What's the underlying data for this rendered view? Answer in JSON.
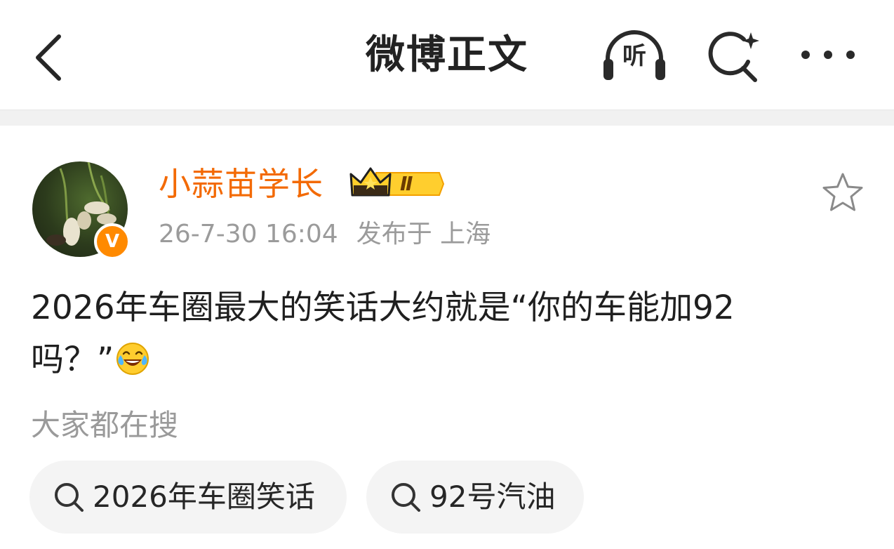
{
  "header": {
    "title": "微博正文",
    "listen_label": "听",
    "icons": [
      "back-arrow-icon",
      "headphones-icon",
      "search-sparkle-icon",
      "more-dots-icon"
    ]
  },
  "author": {
    "name": "小蒜苗学长",
    "badge_level": "Ⅱ",
    "verified_mark": "V",
    "timestamp": "26-7-30 16:04",
    "location_text": "发布于 上海"
  },
  "post": {
    "text_line1": "2026年车圈最大的笑话大约就是“你的车能加92",
    "text_line2": "吗？”",
    "emoji": "laugh-cry-emoji"
  },
  "searching": {
    "title": "大家都在搜",
    "chips": [
      {
        "label": "2026年车圈笑话"
      },
      {
        "label": "92号汽油"
      }
    ]
  },
  "colors": {
    "accent_orange": "#f36a05",
    "verified_orange": "#ff8a00",
    "muted_text": "#9b9b9b",
    "chip_bg": "#f4f4f4",
    "divider": "#f1f1f1"
  }
}
